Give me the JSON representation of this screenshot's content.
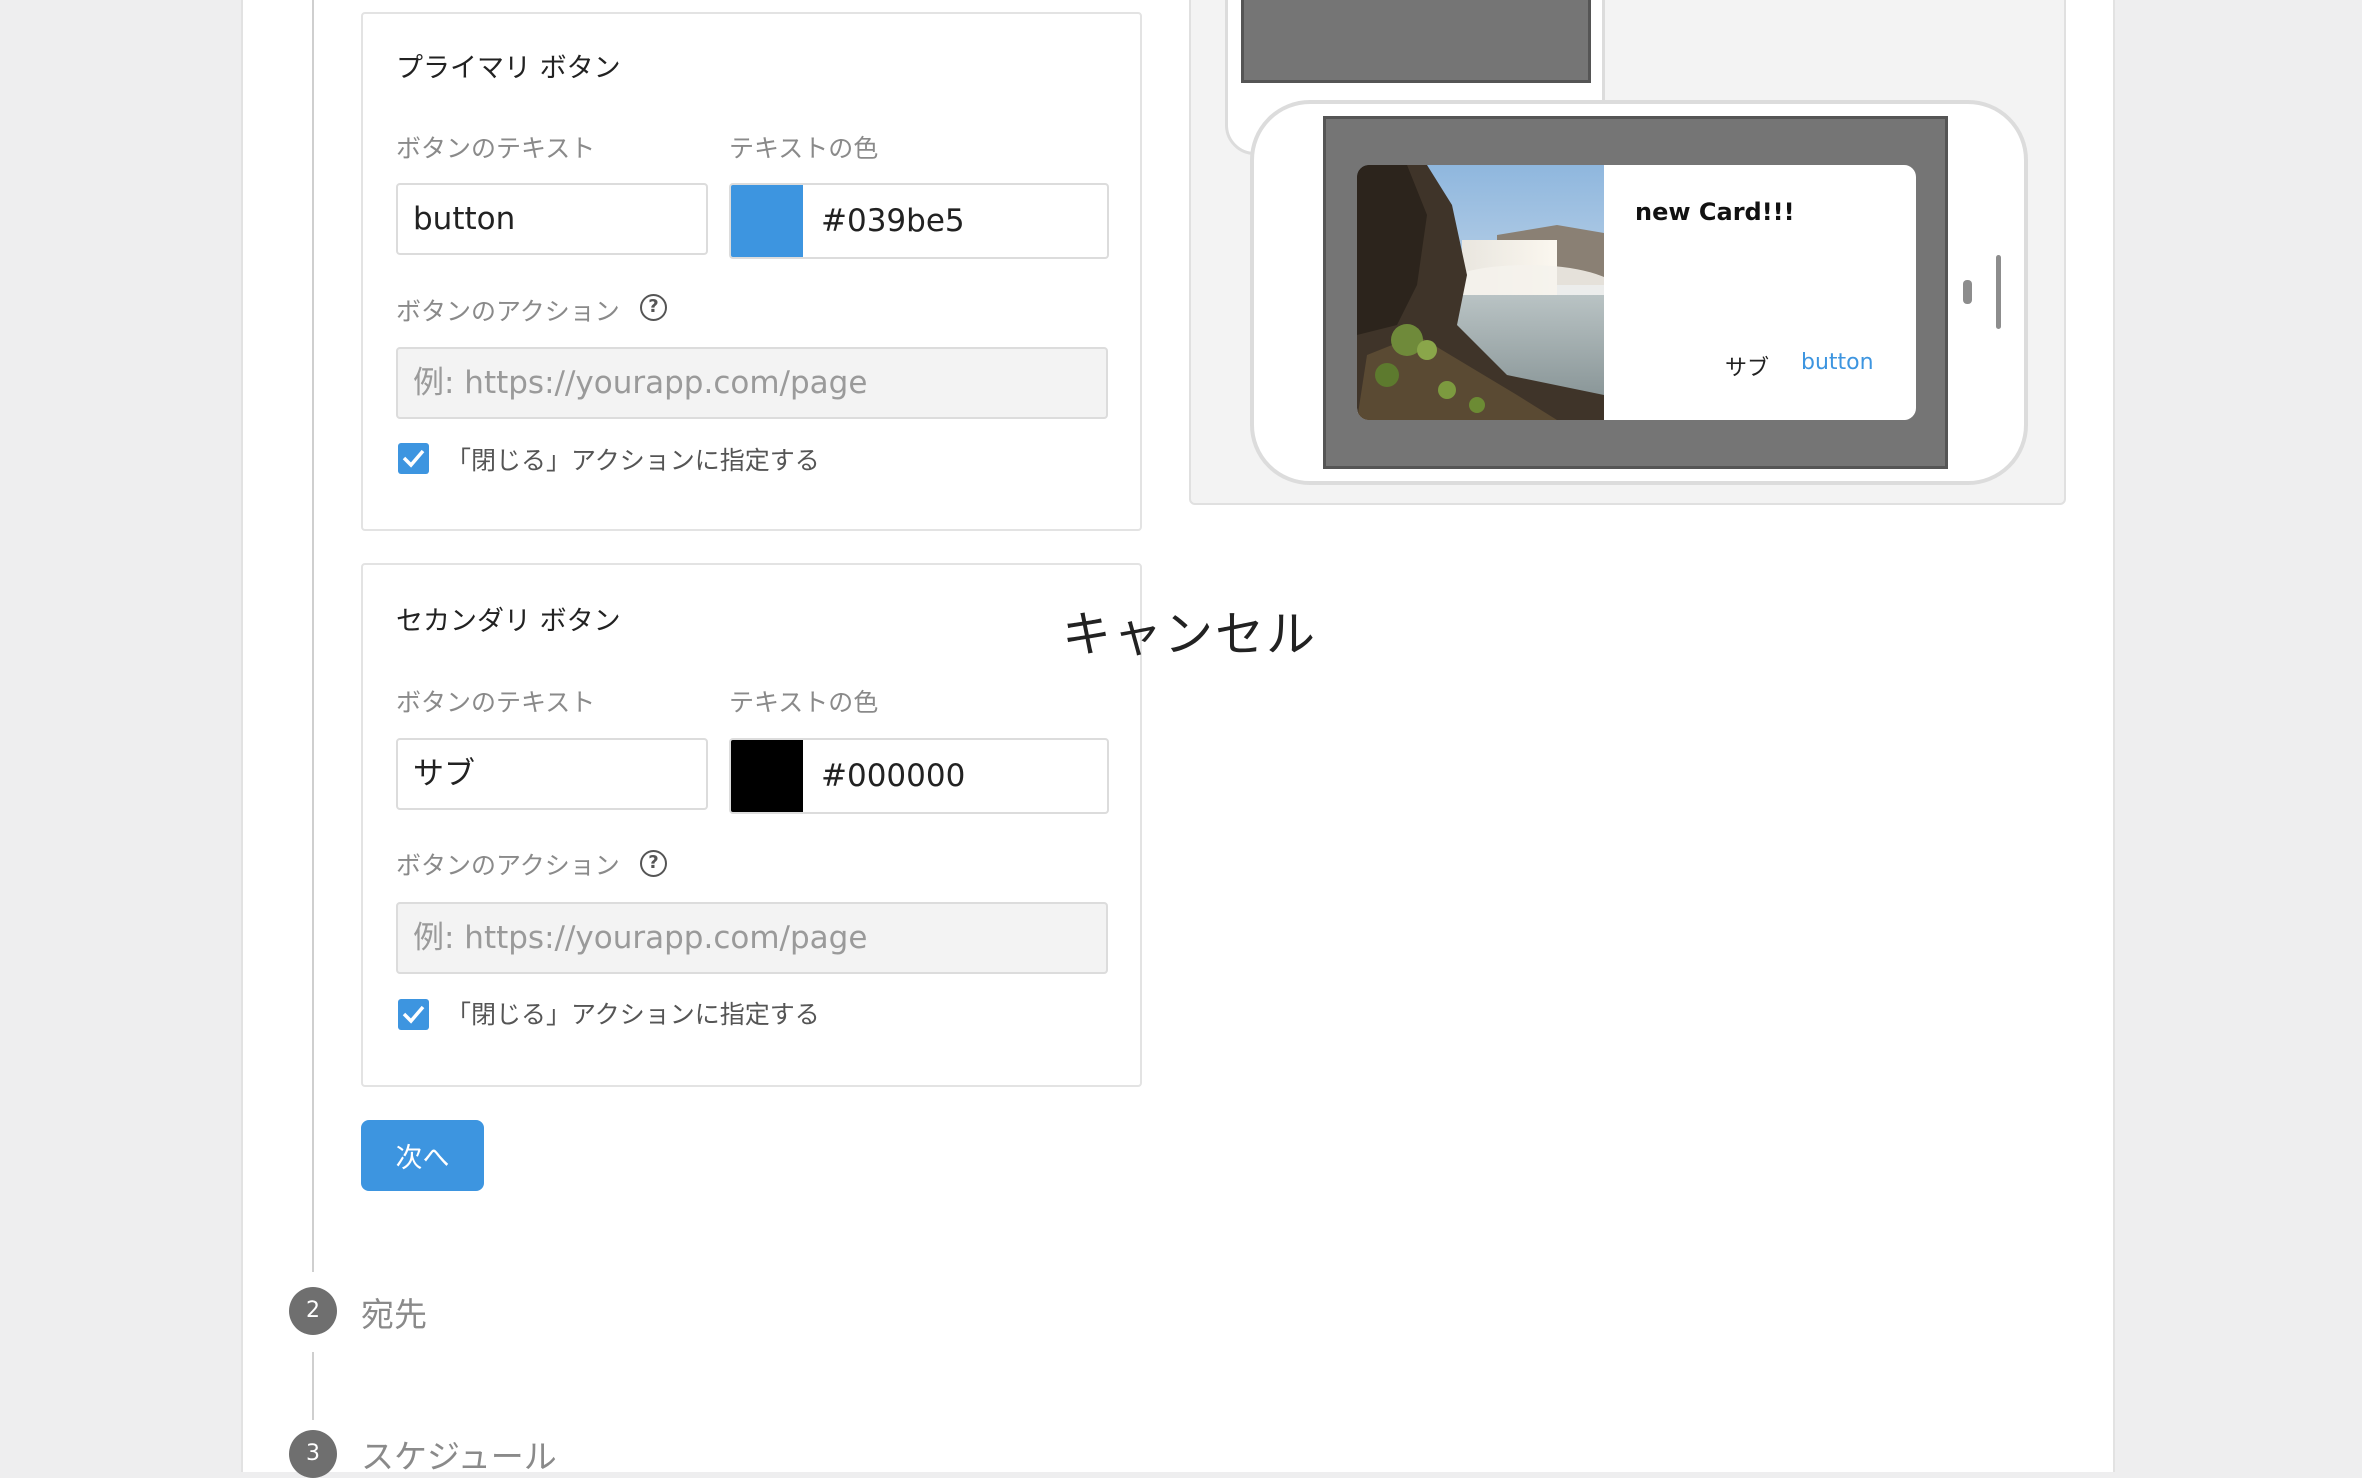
{
  "primary_panel": {
    "title": "プライマリ ボタン",
    "text_label": "ボタンのテキスト",
    "text_value": "button",
    "color_label": "テキストの色",
    "color_value": "#039be5",
    "swatch_color": "#3d95e0",
    "action_label": "ボタンのアクション",
    "action_placeholder": "例: https://yourapp.com/page",
    "close_checkbox_label": "「閉じる」アクションに指定する",
    "close_checked": true
  },
  "cancel_label": "キャンセル",
  "secondary_panel": {
    "title": "セカンダリ ボタン",
    "text_label": "ボタンのテキスト",
    "text_value": "サブ",
    "color_label": "テキストの色",
    "color_value": "#000000",
    "swatch_color": "#000000",
    "action_label": "ボタンのアクション",
    "action_placeholder": "例: https://yourapp.com/page",
    "close_checkbox_label": "「閉じる」アクションに指定する",
    "close_checked": true
  },
  "next_button_label": "次へ",
  "steps": [
    {
      "number": "2",
      "title": "宛先"
    },
    {
      "number": "3",
      "title": "スケジュール"
    }
  ],
  "preview": {
    "card_title": "new Card!!!",
    "secondary_button": "サブ",
    "primary_button": "button",
    "primary_button_color": "#3d95e0"
  },
  "icons": {
    "help": "help-circle-icon",
    "check": "checkmark-icon"
  }
}
